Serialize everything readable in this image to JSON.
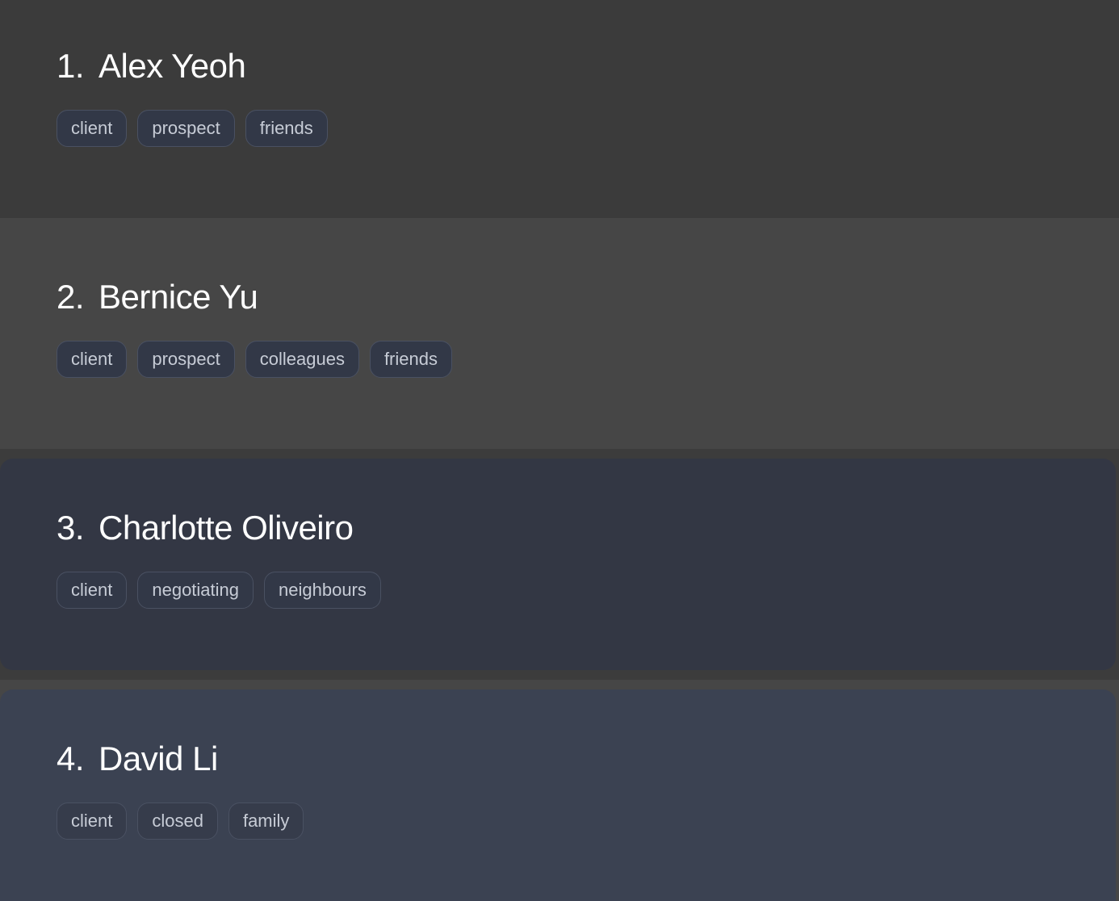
{
  "contacts": [
    {
      "index": "1.",
      "name": "Alex Yeoh",
      "tags": [
        "client",
        "prospect",
        "friends"
      ]
    },
    {
      "index": "2.",
      "name": "Bernice Yu",
      "tags": [
        "client",
        "prospect",
        "colleagues",
        "friends"
      ]
    },
    {
      "index": "3.",
      "name": "Charlotte Oliveiro",
      "tags": [
        "client",
        "negotiating",
        "neighbours"
      ]
    },
    {
      "index": "4.",
      "name": "David Li",
      "tags": [
        "client",
        "closed",
        "family"
      ]
    }
  ],
  "colors": {
    "card_1_bg": "#3b3b3b",
    "card_2_bg": "#464646",
    "card_3_bg": "#333744",
    "card_4_bg": "#3b4252",
    "tag_bg": "#323847",
    "tag_border": "#4a5162",
    "tag_text": "#c7ccd6",
    "name_text": "#ffffff"
  }
}
